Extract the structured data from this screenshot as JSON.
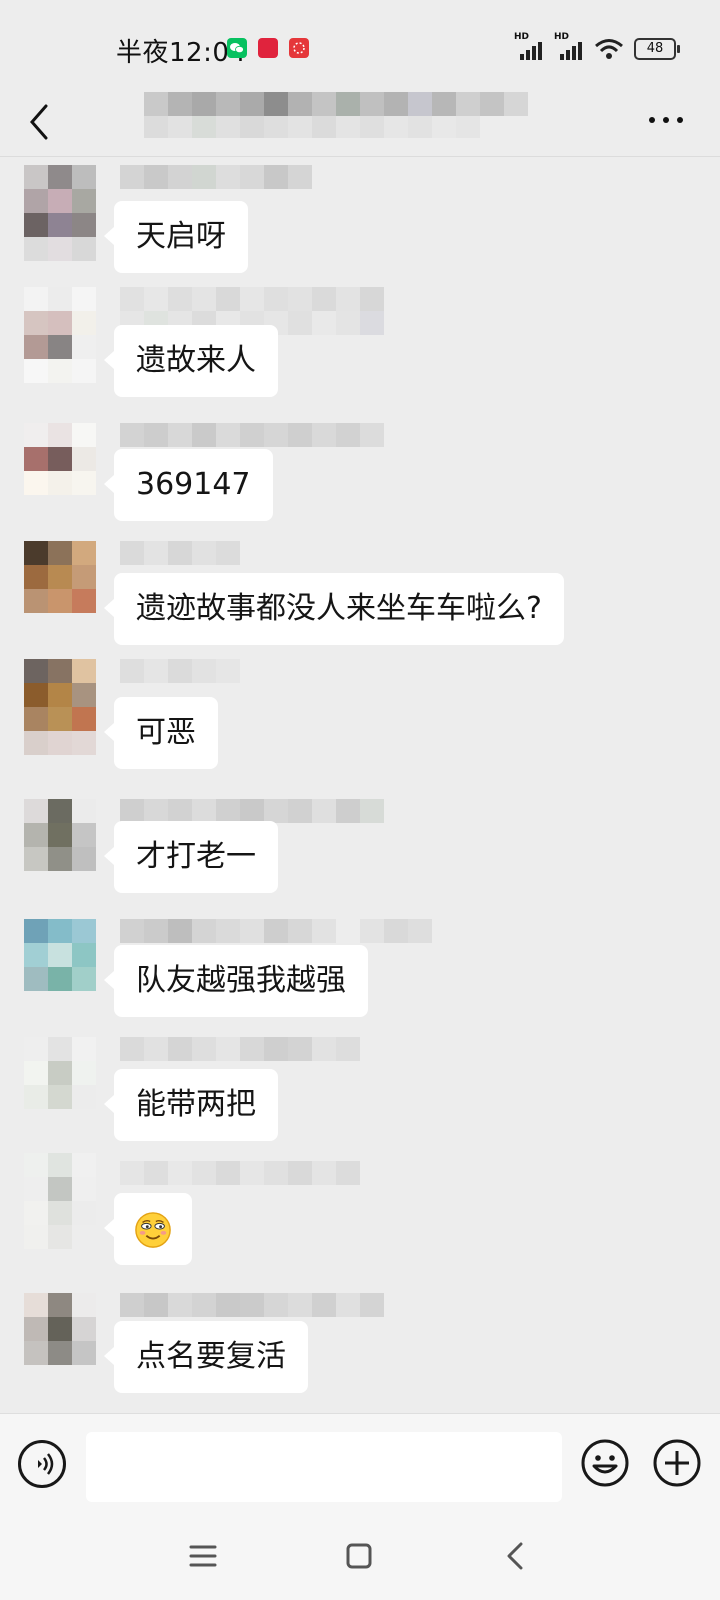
{
  "status_bar": {
    "time": "半夜12:04",
    "network_1": "HD",
    "network_2": "HD",
    "battery": "48"
  },
  "nav": {
    "back_icon": "chevron-left-icon",
    "more_icon": "more-horizontal-icon"
  },
  "messages": [
    {
      "text": "天启呀"
    },
    {
      "text": "遗故来人"
    },
    {
      "text": "369147"
    },
    {
      "text": "遗迹故事都没人来坐车车啦么?"
    },
    {
      "text": "可恶"
    },
    {
      "text": "才打老一"
    },
    {
      "text": "队友越强我越强"
    },
    {
      "text": "能带两把"
    },
    {
      "text": "",
      "emoji": "smirk-face-emoji"
    },
    {
      "text": "点名要复活"
    }
  ],
  "input_bar": {
    "voice_icon": "voice-icon",
    "input_value": "",
    "emoji_icon": "emoji-icon",
    "plus_icon": "plus-circle-icon"
  },
  "system_nav": {
    "menu_icon": "menu-icon",
    "home_icon": "home-icon",
    "back_icon": "back-icon"
  },
  "colors": {
    "background": "#ededed",
    "bubble": "#ffffff",
    "wechat_green": "#07c160"
  }
}
